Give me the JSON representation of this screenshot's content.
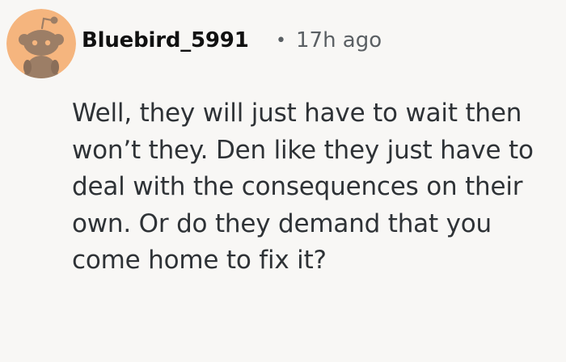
{
  "comment": {
    "author": "Bluebird_5991",
    "separator": "•",
    "timestamp": "17h ago",
    "avatar_icon": "snoo-avatar-icon",
    "avatar_color": "#f5b57e",
    "body": "Well, they will just have to wait then won’t they. Den like they just have to deal with the consequences on their own. Or do they demand that you come home to fix it?"
  }
}
